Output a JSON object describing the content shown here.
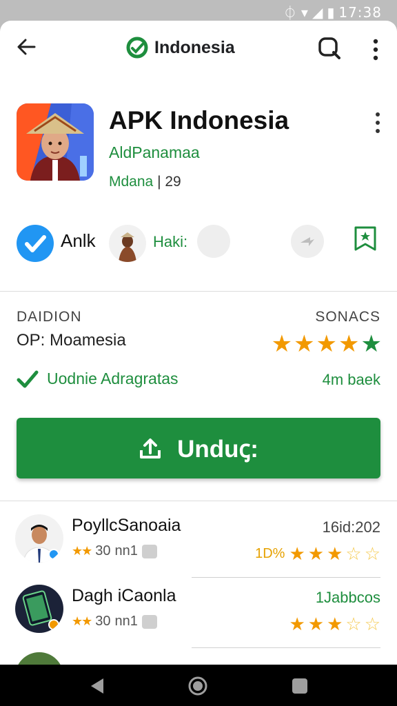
{
  "status_bar": {
    "time": "17:38"
  },
  "app_bar": {
    "title": "Indonesia"
  },
  "app": {
    "title": "APK Indonesia",
    "developer": "AldPanamaa",
    "meta_label": "Mdana",
    "meta_sep": "|",
    "meta_value": "29"
  },
  "badges": {
    "verified_label": "Anlk",
    "user_label": "Haki:"
  },
  "info": {
    "left_heading": "DAIDION",
    "left_value": "OP: Moamesia",
    "right_heading": "SONACS",
    "rating_stars": 5,
    "verify_label": "Uodnie Adragratas",
    "size_label": "4m baek"
  },
  "download": {
    "label": "Unduꞔ:"
  },
  "reviews": [
    {
      "name": "PoyllcSanoaia",
      "mini_rating": "30",
      "count": "nn1",
      "date": "16id:202",
      "percent": "1D%",
      "stars": 3
    },
    {
      "name": "Dagh iCaonla",
      "mini_rating": "30",
      "count": "nn1",
      "date": "1Jabbcos",
      "percent": "",
      "stars": 3
    }
  ],
  "colors": {
    "accent_green": "#1e8e3e",
    "star_gold": "#f29900",
    "verify_blue": "#2196f3"
  },
  "icons": [
    "back-arrow-icon",
    "logo-icon",
    "search-icon",
    "more-vert-icon",
    "checkmark-icon",
    "share-icon",
    "bookmark-icon",
    "upload-icon",
    "back-nav-icon",
    "home-nav-icon",
    "recents-nav-icon"
  ]
}
